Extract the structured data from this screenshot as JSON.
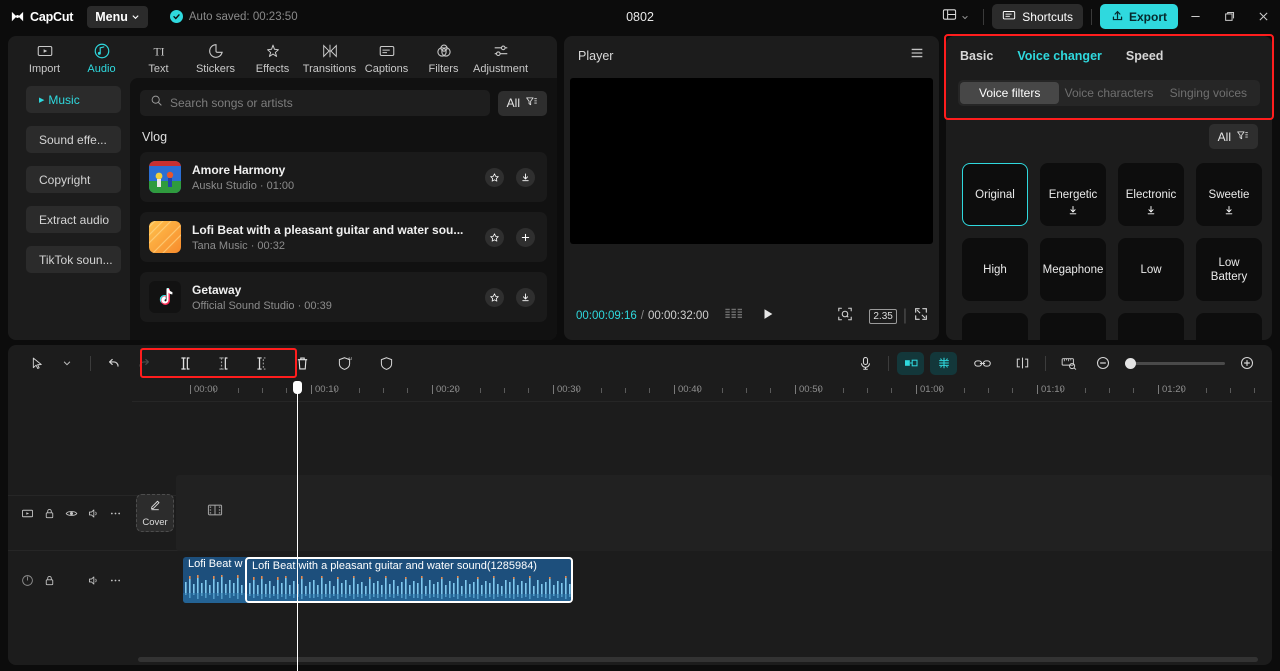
{
  "titlebar": {
    "app_name": "CapCut",
    "menu_label": "Menu",
    "autosave_text": "Auto saved: 00:23:50",
    "project_title": "0802",
    "shortcuts_label": "Shortcuts",
    "export_label": "Export",
    "layout_icon": "layout-icon",
    "minimize_icon": "minimize-icon",
    "maximize_icon": "maximize-icon",
    "close_icon": "close-icon",
    "accent_color": "#2fd9de"
  },
  "function_tabs": [
    {
      "label": "Import",
      "icon": "import-icon",
      "active": false
    },
    {
      "label": "Audio",
      "icon": "audio-note-icon",
      "active": true
    },
    {
      "label": "Text",
      "icon": "text-icon",
      "active": false
    },
    {
      "label": "Stickers",
      "icon": "sticker-icon",
      "active": false
    },
    {
      "label": "Effects",
      "icon": "effects-sparkle-icon",
      "active": false
    },
    {
      "label": "Transitions",
      "icon": "transitions-icon",
      "active": false
    },
    {
      "label": "Captions",
      "icon": "captions-icon",
      "active": false
    },
    {
      "label": "Filters",
      "icon": "filters-icon",
      "active": false
    },
    {
      "label": "Adjustment",
      "icon": "adjustment-sliders-icon",
      "active": false
    }
  ],
  "audio_categories": [
    {
      "label": "Music",
      "active": true
    },
    {
      "label": "Sound effe...",
      "active": false
    },
    {
      "label": "Copyright",
      "active": false
    },
    {
      "label": "Extract audio",
      "active": false
    },
    {
      "label": "TikTok soun...",
      "active": false
    }
  ],
  "music_library": {
    "search_placeholder": "Search songs or artists",
    "search_value": "",
    "filter_label": "All",
    "section_title": "Vlog",
    "songs": [
      {
        "name": "Amore Harmony",
        "artist": "Ausku Studio",
        "duration": "01:00",
        "subtitle": "Ausku Studio · 01:00",
        "action_icon": "download-icon",
        "favorite_icon": "star-icon"
      },
      {
        "name": "Lofi Beat with a pleasant guitar and water sou...",
        "artist": "Tana Music",
        "duration": "00:32",
        "subtitle": "Tana Music · 00:32",
        "action_icon": "plus-icon",
        "favorite_icon": "star-icon"
      },
      {
        "name": "Getaway",
        "artist": "Official Sound Studio",
        "duration": "00:39",
        "subtitle": "Official Sound Studio · 00:39",
        "action_icon": "download-icon",
        "favorite_icon": "star-icon"
      }
    ]
  },
  "player": {
    "title": "Player",
    "menu_icon": "hamburger-icon",
    "current_time": "00:00:09:16",
    "time_separator": "/",
    "total_time": "00:00:32:00",
    "frames_icon": "frames-icon",
    "play_icon": "play-icon",
    "snapshot_icon": "snapshot-icon",
    "ratio_label": "2.35",
    "fullscreen_icon": "fullscreen-icon"
  },
  "right_panel": {
    "tabs": [
      {
        "label": "Basic",
        "active": false
      },
      {
        "label": "Voice changer",
        "active": true
      },
      {
        "label": "Speed",
        "active": false
      }
    ],
    "segments": [
      {
        "label": "Voice filters",
        "active": true
      },
      {
        "label": "Voice characters",
        "active": false
      },
      {
        "label": "Singing voices",
        "active": false
      }
    ],
    "filter_label": "All",
    "voice_filters": [
      {
        "label": "Original",
        "selected": true,
        "downloadable": false
      },
      {
        "label": "Energetic",
        "selected": false,
        "downloadable": true
      },
      {
        "label": "Electronic",
        "selected": false,
        "downloadable": true
      },
      {
        "label": "Sweetie",
        "selected": false,
        "downloadable": true
      },
      {
        "label": "High",
        "selected": false,
        "downloadable": false
      },
      {
        "label": "Megaphone",
        "selected": false,
        "downloadable": false
      },
      {
        "label": "Low",
        "selected": false,
        "downloadable": false
      },
      {
        "label": "Low Battery",
        "selected": false,
        "downloadable": false
      }
    ],
    "highlight_color": "#ff1d1d"
  },
  "timeline": {
    "tools_left": [
      {
        "name": "select-cursor-icon",
        "label": "Select"
      },
      {
        "name": "chevron-down-icon",
        "label": "More select modes"
      },
      {
        "name": "undo-icon",
        "label": "Undo"
      },
      {
        "name": "redo-icon",
        "label": "Redo"
      },
      {
        "name": "split-icon",
        "label": "Split"
      },
      {
        "name": "trim-left-icon",
        "label": "Delete left part"
      },
      {
        "name": "trim-right-icon",
        "label": "Delete right part"
      },
      {
        "name": "delete-trash-icon",
        "label": "Delete"
      },
      {
        "name": "ai-shield-icon",
        "label": "AI tools"
      },
      {
        "name": "shield-icon",
        "label": "Protect"
      }
    ],
    "tools_right": [
      {
        "name": "microphone-icon",
        "label": "Record"
      },
      {
        "name": "mirror-icon",
        "label": "Mirror"
      },
      {
        "name": "freeze-icon",
        "label": "Freeze"
      },
      {
        "name": "link-icon",
        "label": "Link"
      },
      {
        "name": "snap-icon",
        "label": "Snap"
      },
      {
        "name": "ruler-icon",
        "label": "Preview ruler"
      },
      {
        "name": "zoom-out-icon",
        "label": "Zoom out"
      },
      {
        "name": "zoom-in-icon",
        "label": "Zoom in"
      }
    ],
    "ruler_labels": [
      "00:00",
      "00:10",
      "00:20",
      "00:30",
      "00:40",
      "00:50",
      "01:00",
      "01:10",
      "01:20"
    ],
    "highlight_color": "#ff1d1d",
    "cover_label": "Cover",
    "cover_icon": "pencil-icon",
    "video_track_icon": "film-strip-icon",
    "video_track_head_icons": [
      "thumbnail-icon",
      "lock-icon",
      "eye-icon",
      "volume-icon",
      "more-icon"
    ],
    "audio_track_head_icons": [
      "audio-wave-icon",
      "lock-icon",
      "volume-icon",
      "more-icon"
    ],
    "clips": [
      {
        "label": "Lofi Beat w",
        "selected": false
      },
      {
        "label": "Lofi Beat with a pleasant guitar and water sound(1285984)",
        "selected": true
      }
    ],
    "clip_color": "#1d4f7c"
  }
}
